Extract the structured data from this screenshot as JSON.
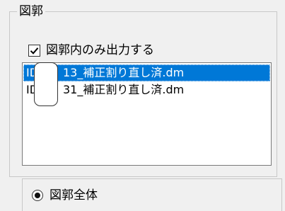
{
  "group": {
    "title": "図郭"
  },
  "checkbox": {
    "label": "図郭内のみ出力する",
    "checked": true
  },
  "list": {
    "items": [
      {
        "prefix": "ID",
        "suffix": "13_補正割り直し済.dm",
        "selected": true
      },
      {
        "prefix": "ID",
        "suffix": "31_補正割り直し済.dm",
        "selected": false
      }
    ]
  },
  "radio": {
    "label": "図郭全体",
    "selected": true
  },
  "colors": {
    "selection": "#0078d7"
  }
}
